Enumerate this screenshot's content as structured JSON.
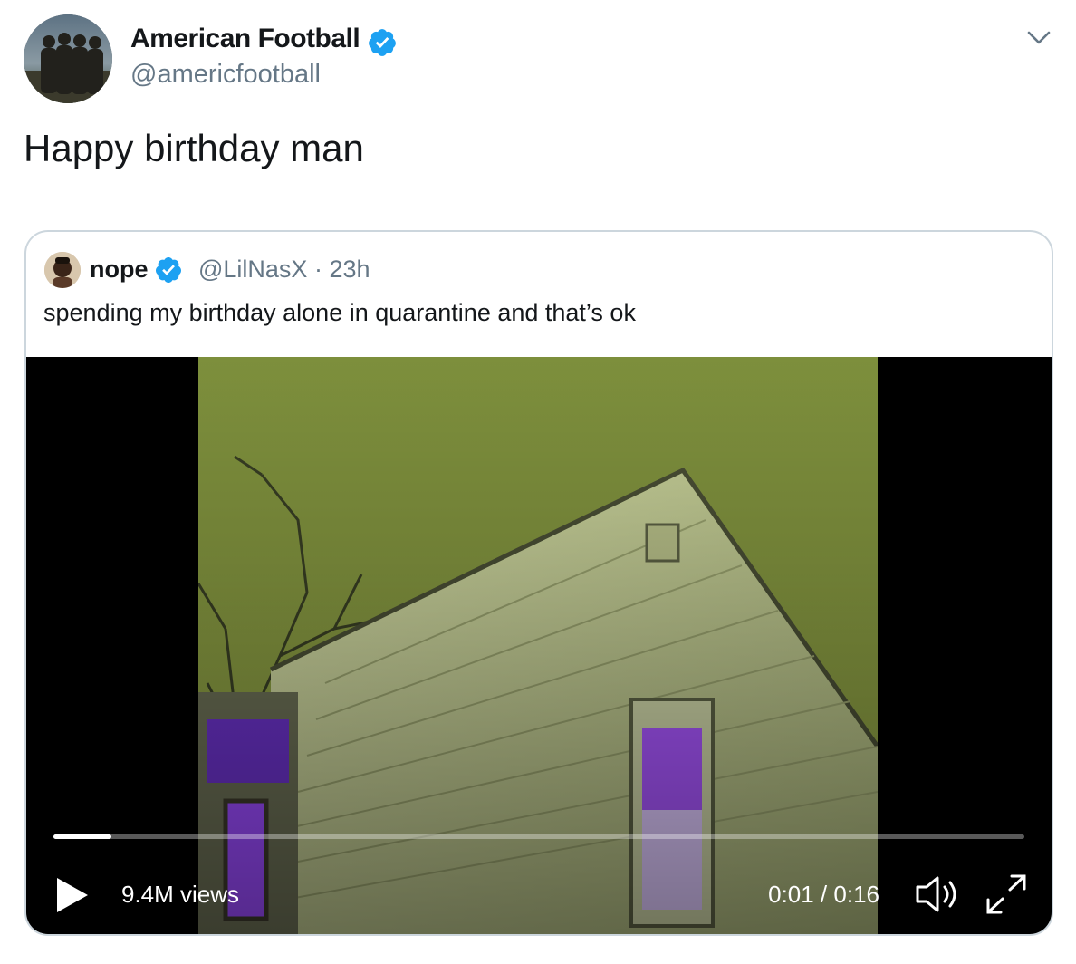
{
  "author": {
    "display_name": "American Football",
    "handle": "@americfootball",
    "avatar_icon": "band-photo-avatar",
    "verified": true
  },
  "tweet": {
    "text": "Happy birthday man"
  },
  "quoted_tweet": {
    "display_name": "nope",
    "handle": "@LilNasX",
    "time": "· 23h",
    "verified": true,
    "text": "spending my birthday alone in quarantine and that’s ok",
    "video": {
      "views": "9.4M views",
      "time": "0:01 / 0:16",
      "progress": 0.06
    }
  },
  "colors": {
    "verified_blue": "#1da1f2",
    "secondary_text": "#657786",
    "border": "#ccd6dd"
  }
}
